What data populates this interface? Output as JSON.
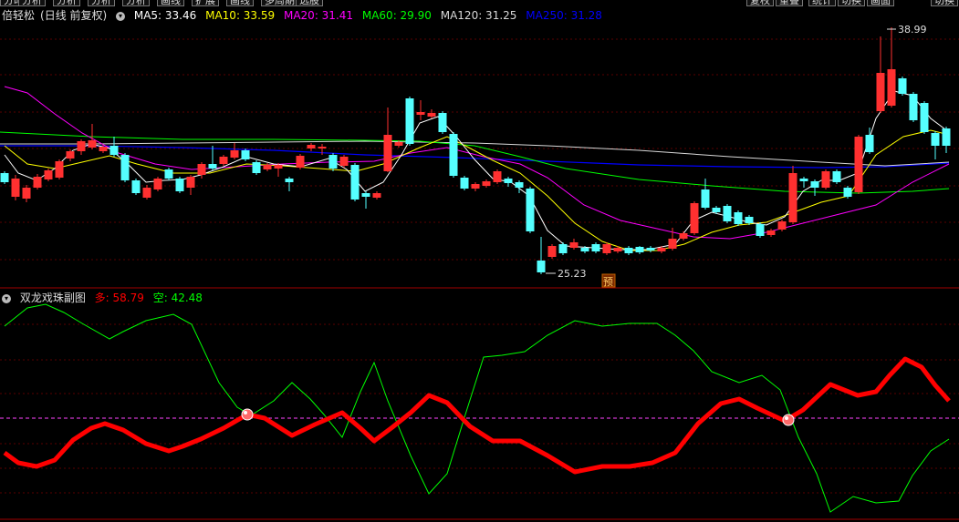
{
  "toolbar": {
    "left_items": [
      "分时",
      "分析",
      "分析",
      "分析",
      "分析",
      "画线",
      "扩展",
      "画线",
      "多周期",
      "选股"
    ],
    "right_items": [
      "复权",
      "重叠",
      "统计",
      "切换",
      "画面",
      "切换"
    ]
  },
  "main_panel": {
    "stock_name": "倍轻松",
    "period_label": "(日线 前复权)",
    "ma_labels": [
      {
        "text": "MA5: 33.46",
        "color": "#ffffff"
      },
      {
        "text": "MA10: 33.59",
        "color": "#ffff00"
      },
      {
        "text": "MA20: 31.41",
        "color": "#ff00ff"
      },
      {
        "text": "MA60: 29.90",
        "color": "#00ff00"
      },
      {
        "text": "MA120: 31.25",
        "color": "#d8d8d8"
      },
      {
        "text": "MA250: 31.28",
        "color": "#0000ff"
      }
    ],
    "high_label": "38.99",
    "low_label": "25.23",
    "forecast_badge": "预"
  },
  "sub_panel": {
    "title": "双龙戏珠副图",
    "long_label": "多: 58.79",
    "short_label": "空: 42.48",
    "long_color": "#ff0000",
    "short_color": "#00ff00"
  },
  "colors": {
    "up": "#ff3030",
    "down": "#55ffff",
    "grid": "#5a0000",
    "divider": "#a00000"
  }
}
